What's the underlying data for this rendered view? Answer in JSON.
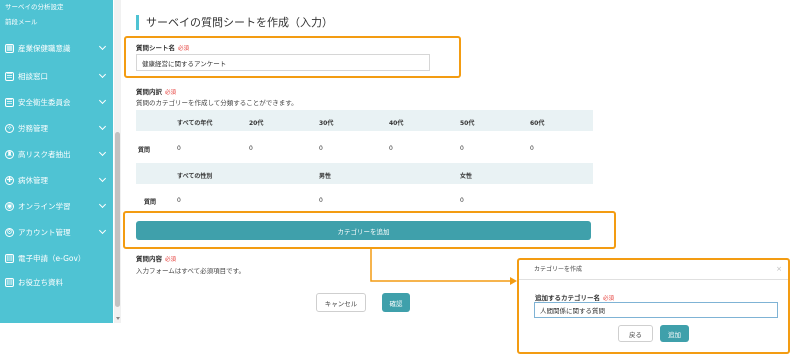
{
  "sidebar": {
    "top_items": [
      "サーベイの分析設定",
      "前段メール"
    ],
    "items": [
      {
        "icon": "building-icon",
        "glyph": "▦",
        "label": "産業保健職意識"
      },
      {
        "icon": "users-icon",
        "glyph": "☰",
        "label": "相談窓口"
      },
      {
        "icon": "shield-icon",
        "glyph": "☰",
        "label": "安全衛生委員会"
      },
      {
        "icon": "labor-icon",
        "glyph": "✧",
        "label": "労務管理"
      },
      {
        "icon": "risk-icon",
        "glyph": "♜",
        "label": "高リスク者抽出"
      },
      {
        "icon": "health-icon",
        "glyph": "✚",
        "label": "病休管理"
      },
      {
        "icon": "online-icon",
        "glyph": "◉",
        "label": "オンライン学習"
      },
      {
        "icon": "account-icon",
        "glyph": "⚙",
        "label": "アカウント管理"
      },
      {
        "icon": "egov-icon",
        "glyph": "▤",
        "label": "電子申請（e-Gov）"
      },
      {
        "icon": "docs-icon",
        "glyph": "▤",
        "label": "お役立ち資料"
      }
    ]
  },
  "page": {
    "title": "サーベイの質問シートを作成（入力）",
    "sheet_name_label": "質問シート名",
    "required": "必須",
    "sheet_name_value": "健康経営に関するアンケート",
    "content_label": "質問内訳",
    "content_note": "質問のカテゴリーを作成して分類することができます。",
    "table": {
      "row1_headers": [
        "すべての年代",
        "20代",
        "30代",
        "40代",
        "50代",
        "60代"
      ],
      "row1_label": "質問",
      "row1_values": [
        "0",
        "0",
        "0",
        "0",
        "0",
        "0"
      ],
      "row2_headers": [
        "すべての性別",
        "男性",
        "女性"
      ],
      "row2_label": "質問",
      "row2_values": [
        "0",
        "0",
        "0"
      ]
    },
    "add_category_button": "カテゴリーを追加",
    "content2_label": "質問内容",
    "content2_note": "入力フォームはすべて必須項目です。",
    "cancel_button": "キャンセル",
    "confirm_button": "確認"
  },
  "modal": {
    "title": "カテゴリーを作成",
    "close_glyph": "×",
    "field_label": "追加するカテゴリー名",
    "required": "必須",
    "field_value": "人間関係に関する質問",
    "back_button": "戻る",
    "add_button": "追加"
  },
  "colors": {
    "sidebar": "#4fc3d3",
    "accent": "#3fa0ab",
    "highlight": "#f39c12",
    "required": "#e53935"
  }
}
